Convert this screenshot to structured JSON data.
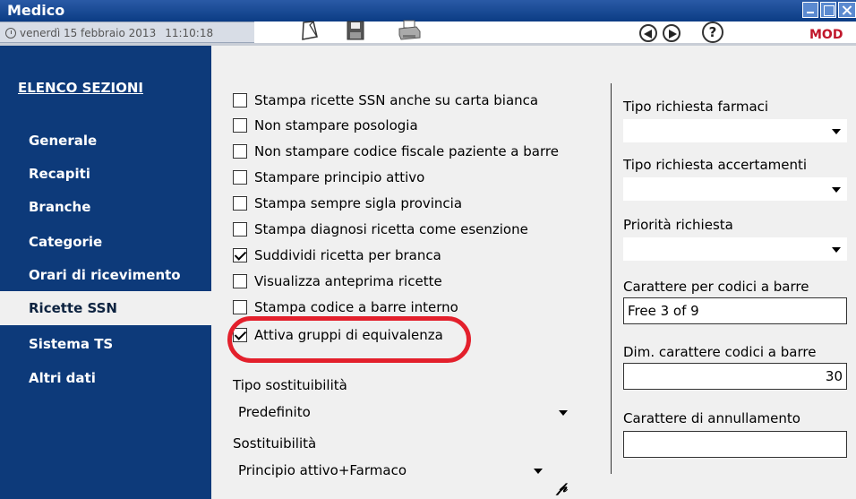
{
  "window": {
    "title": "Medico",
    "date": "venerdì 15 febbraio 2013",
    "time": "11:10:18",
    "mode": "MOD"
  },
  "toolbar": {
    "icons": [
      "document-icon",
      "save-icon",
      "print-icon",
      "back-icon",
      "forward-icon",
      "help-icon"
    ],
    "help_label": "?"
  },
  "sidebar": {
    "title": "ELENCO SEZIONI",
    "items": [
      {
        "label": "Generale"
      },
      {
        "label": "Recapiti"
      },
      {
        "label": "Branche"
      },
      {
        "label": "Categorie"
      },
      {
        "label": "Orari di ricevimento"
      },
      {
        "label": "Ricette SSN",
        "active": true
      },
      {
        "label": "Sistema TS"
      },
      {
        "label": "Altri dati"
      }
    ]
  },
  "options": [
    {
      "label": "Stampa ricette SSN anche su carta bianca",
      "checked": false
    },
    {
      "label": "Non stampare posologia",
      "checked": false
    },
    {
      "label": "Non stampare codice fiscale paziente a barre",
      "checked": false
    },
    {
      "label": "Stampare principio attivo",
      "checked": false
    },
    {
      "label": "Stampa sempre sigla provincia",
      "checked": false
    },
    {
      "label": "Stampa diagnosi ricetta come esenzione",
      "checked": false
    },
    {
      "label": "Suddividi ricetta per branca",
      "checked": true
    },
    {
      "label": "Visualizza anteprima ricette",
      "checked": false
    },
    {
      "label": "Stampa codice a barre interno",
      "checked": false
    },
    {
      "label": "Attiva gruppi di equivalenza",
      "checked": true
    }
  ],
  "substitutability": {
    "type_label": "Tipo sostituibilità",
    "type_value": "Predefinito",
    "label": "Sostituibilità",
    "value": "Principio attivo+Farmaco"
  },
  "right_panel": {
    "tipo_farmaci_label": "Tipo richiesta farmaci",
    "tipo_farmaci_value": "",
    "tipo_accertamenti_label": "Tipo richiesta accertamenti",
    "tipo_accertamenti_value": "",
    "priorita_label": "Priorità richiesta",
    "priorita_value": "",
    "carattere_barre_label": "Carattere per codici a barre",
    "carattere_barre_value": "Free 3 of 9",
    "dim_carattere_label": "Dim. carattere codici a barre",
    "dim_carattere_value": "30",
    "annullamento_label": "Carattere di annullamento",
    "annullamento_value": ""
  },
  "colors": {
    "titlebar": "#0b3c84",
    "sidebar": "#0d3a7a",
    "highlight": "#e3202c",
    "mode": "#c0172b"
  }
}
